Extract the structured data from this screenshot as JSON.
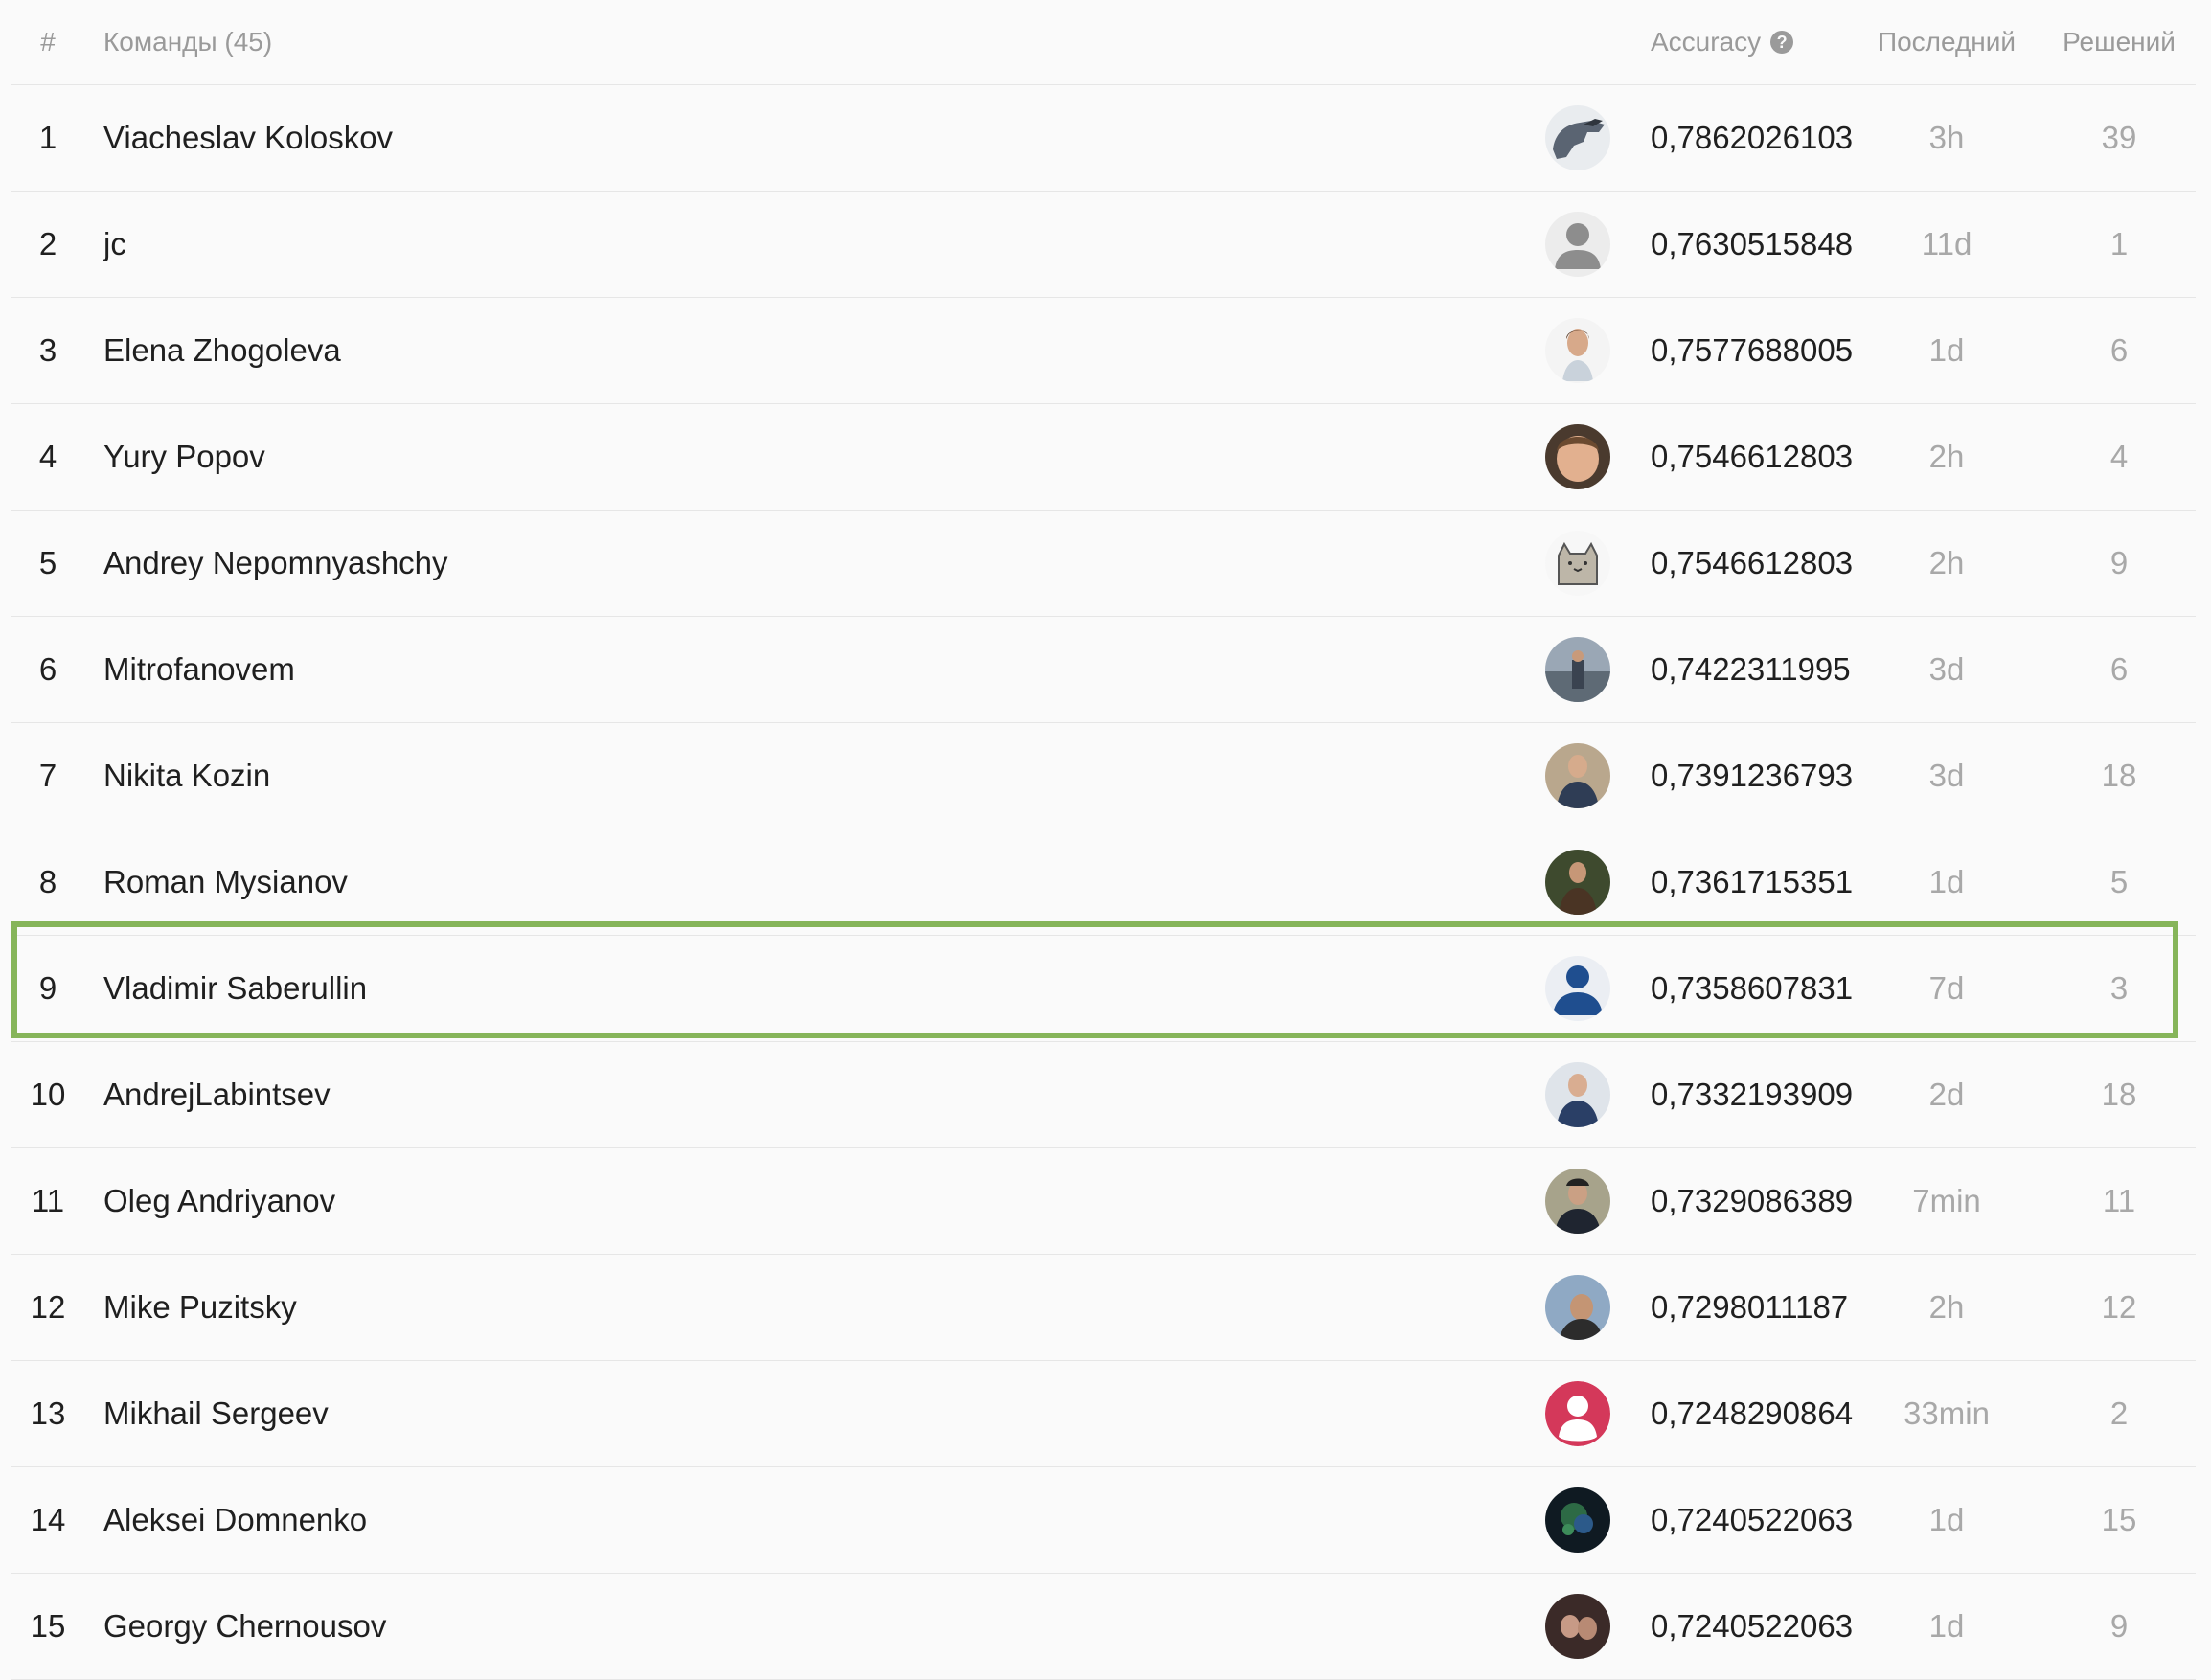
{
  "header": {
    "rank_label": "#",
    "teams_label": "Команды (45)",
    "score_label": "Accuracy",
    "help_icon": "question-circle-icon",
    "last_label": "Последний",
    "solved_label": "Решений"
  },
  "highlight_color": "#86b55a",
  "rows": [
    {
      "rank": "1",
      "name": "Viacheslav Koloskov",
      "avatar": "photo",
      "score": "0,7862026103",
      "last": "3h",
      "solved": "39"
    },
    {
      "rank": "2",
      "name": "jc",
      "avatar": "default-user-gray",
      "score": "0,7630515848",
      "last": "11d",
      "solved": "1"
    },
    {
      "rank": "3",
      "name": "Elena Zhogoleva",
      "avatar": "photo",
      "score": "0,7577688005",
      "last": "1d",
      "solved": "6"
    },
    {
      "rank": "4",
      "name": "Yury Popov",
      "avatar": "photo",
      "score": "0,7546612803",
      "last": "2h",
      "solved": "4"
    },
    {
      "rank": "5",
      "name": "Andrey Nepomnyashchy",
      "avatar": "cat-drawing",
      "score": "0,7546612803",
      "last": "2h",
      "solved": "9"
    },
    {
      "rank": "6",
      "name": "Mitrofanovem",
      "avatar": "photo",
      "score": "0,7422311995",
      "last": "3d",
      "solved": "6"
    },
    {
      "rank": "7",
      "name": "Nikita Kozin",
      "avatar": "photo",
      "score": "0,7391236793",
      "last": "3d",
      "solved": "18"
    },
    {
      "rank": "8",
      "name": "Roman Mysianov",
      "avatar": "photo",
      "score": "0,7361715351",
      "last": "1d",
      "solved": "5"
    },
    {
      "rank": "9",
      "name": "Vladimir Saberullin",
      "avatar": "default-user-blue",
      "score": "0,7358607831",
      "last": "7d",
      "solved": "3",
      "highlighted": true
    },
    {
      "rank": "10",
      "name": "AndrejLabintsev",
      "avatar": "photo",
      "score": "0,7332193909",
      "last": "2d",
      "solved": "18"
    },
    {
      "rank": "11",
      "name": "Oleg Andriyanov",
      "avatar": "photo",
      "score": "0,7329086389",
      "last": "7min",
      "solved": "11"
    },
    {
      "rank": "12",
      "name": "Mike Puzitsky",
      "avatar": "photo",
      "score": "0,7298011187",
      "last": "2h",
      "solved": "12"
    },
    {
      "rank": "13",
      "name": "Mikhail Sergeev",
      "avatar": "default-user-red",
      "score": "0,7248290864",
      "last": "33min",
      "solved": "2"
    },
    {
      "rank": "14",
      "name": "Aleksei Domnenko",
      "avatar": "photo",
      "score": "0,7240522063",
      "last": "1d",
      "solved": "15"
    },
    {
      "rank": "15",
      "name": "Georgy Chernousov",
      "avatar": "photo",
      "score": "0,7240522063",
      "last": "1d",
      "solved": "9"
    }
  ]
}
